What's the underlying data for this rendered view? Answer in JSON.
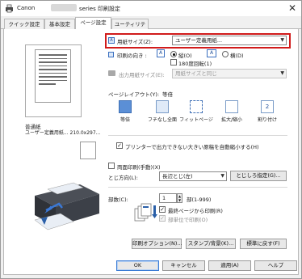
{
  "window": {
    "title_prefix": "Canon",
    "title_suffix": "series 印刷設定",
    "close_glyph": "✕"
  },
  "tabs": [
    {
      "label": "クイック設定",
      "active": false
    },
    {
      "label": "基本設定",
      "active": false
    },
    {
      "label": "ページ設定",
      "active": true
    },
    {
      "label": "ユーティリティ",
      "active": false
    }
  ],
  "preview": {
    "paper_label": "普通紙",
    "size_label": "ユーザー定義用紙... 210.0x297..."
  },
  "page_setup": {
    "paper_size_label": "用紙サイズ(Z):",
    "paper_size_value": "ユーザー定義用紙...",
    "orientation_label": "印刷の向き :",
    "portrait_label": "縦(O)",
    "landscape_label": "横(D)",
    "rotate_label": "180度回転(1)",
    "output_size_label": "出力用紙サイズ(E):",
    "output_size_value": "用紙サイズと同じ",
    "layout_label": "ページレイアウト(Y):",
    "layout_value": "等倍",
    "layouts": [
      {
        "label": "等倍",
        "selected": true
      },
      {
        "label": "フチなし全面",
        "selected": false
      },
      {
        "label": "フィットページ",
        "selected": false
      },
      {
        "label": "拡大/縮小",
        "selected": false
      },
      {
        "label": "割り付け",
        "selected": false
      }
    ],
    "auto_reduce_label": "プリンターで出力できない大きい原稿を自動縮小する(H)",
    "duplex_label": "両面印刷(手動)(X)",
    "binding_label": "とじ方向(L):",
    "binding_value": "長辺とじ(左)",
    "margin_button": "とじしろ指定(G)...",
    "copies_label": "部数(C):",
    "copies_value": "1",
    "copies_range": "部(1-999)",
    "last_page_first_label": "最終ページから印刷(R)",
    "collate_label": "部単位で印刷(O)"
  },
  "buttons": {
    "print_options": "印刷オプション(N)...",
    "stamp_bg": "スタンプ/背景(K)...",
    "defaults": "標準に戻す(F)",
    "ok": "OK",
    "cancel": "キャンセル",
    "apply": "適用(A)",
    "help": "ヘルプ"
  },
  "colors": {
    "highlight": "#d11b1b",
    "selected_tile": "#5b8fd6"
  }
}
